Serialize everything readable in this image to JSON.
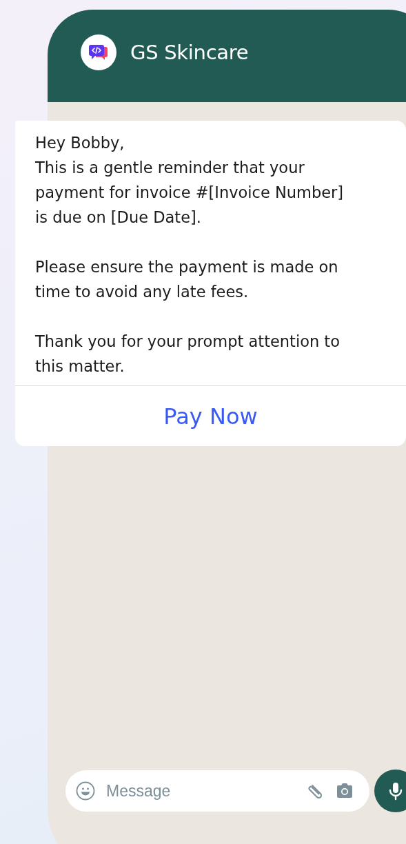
{
  "header": {
    "title": "GS Skincare"
  },
  "message": {
    "paragraphs": [
      "Hey Bobby,\nThis is a gentle reminder that your payment for invoice #[Invoice Number] is due on [Due Date].",
      "Please ensure the payment is made on time to avoid any late fees.",
      "Thank you for your prompt attention to this matter."
    ],
    "button": "Pay Now"
  },
  "composer": {
    "placeholder": "Message"
  }
}
